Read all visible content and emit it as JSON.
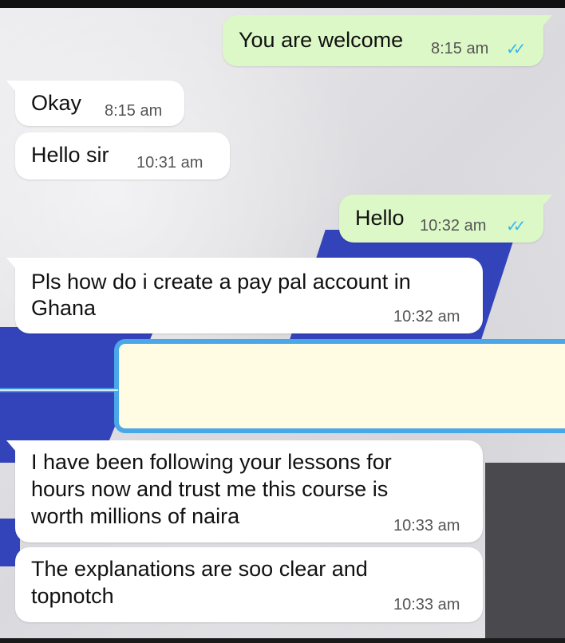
{
  "messages": [
    {
      "direction": "outgoing",
      "text": "You are welcome",
      "time": "8:15 am",
      "status": "read"
    },
    {
      "direction": "incoming",
      "text": "Okay",
      "time": "8:15 am"
    },
    {
      "direction": "incoming",
      "text": "Hello sir",
      "time": "10:31 am"
    },
    {
      "direction": "outgoing",
      "text": "Hello",
      "time": "10:32 am",
      "status": "read"
    },
    {
      "direction": "incoming",
      "text_lines": [
        "Pls how do i create a pay pal account in",
        "Ghana"
      ],
      "time": "10:32 am"
    },
    {
      "direction": "incoming",
      "text_lines": [
        "I have been following your lessons for",
        "hours now and trust me this course is",
        "worth millions of naira"
      ],
      "time": "10:33 am"
    },
    {
      "direction": "incoming",
      "text_lines": [
        "The explanations are soo clear and",
        "topnotch"
      ],
      "time": "10:33 am"
    }
  ],
  "icons": {
    "read_receipt": "double-check-icon"
  },
  "colors": {
    "incoming_bubble": "#ffffff",
    "outgoing_bubble": "#dcf8c6",
    "read_tick": "#34b7f1",
    "highlight_border": "#4aa7e8",
    "highlight_fill": "#fffce3"
  }
}
